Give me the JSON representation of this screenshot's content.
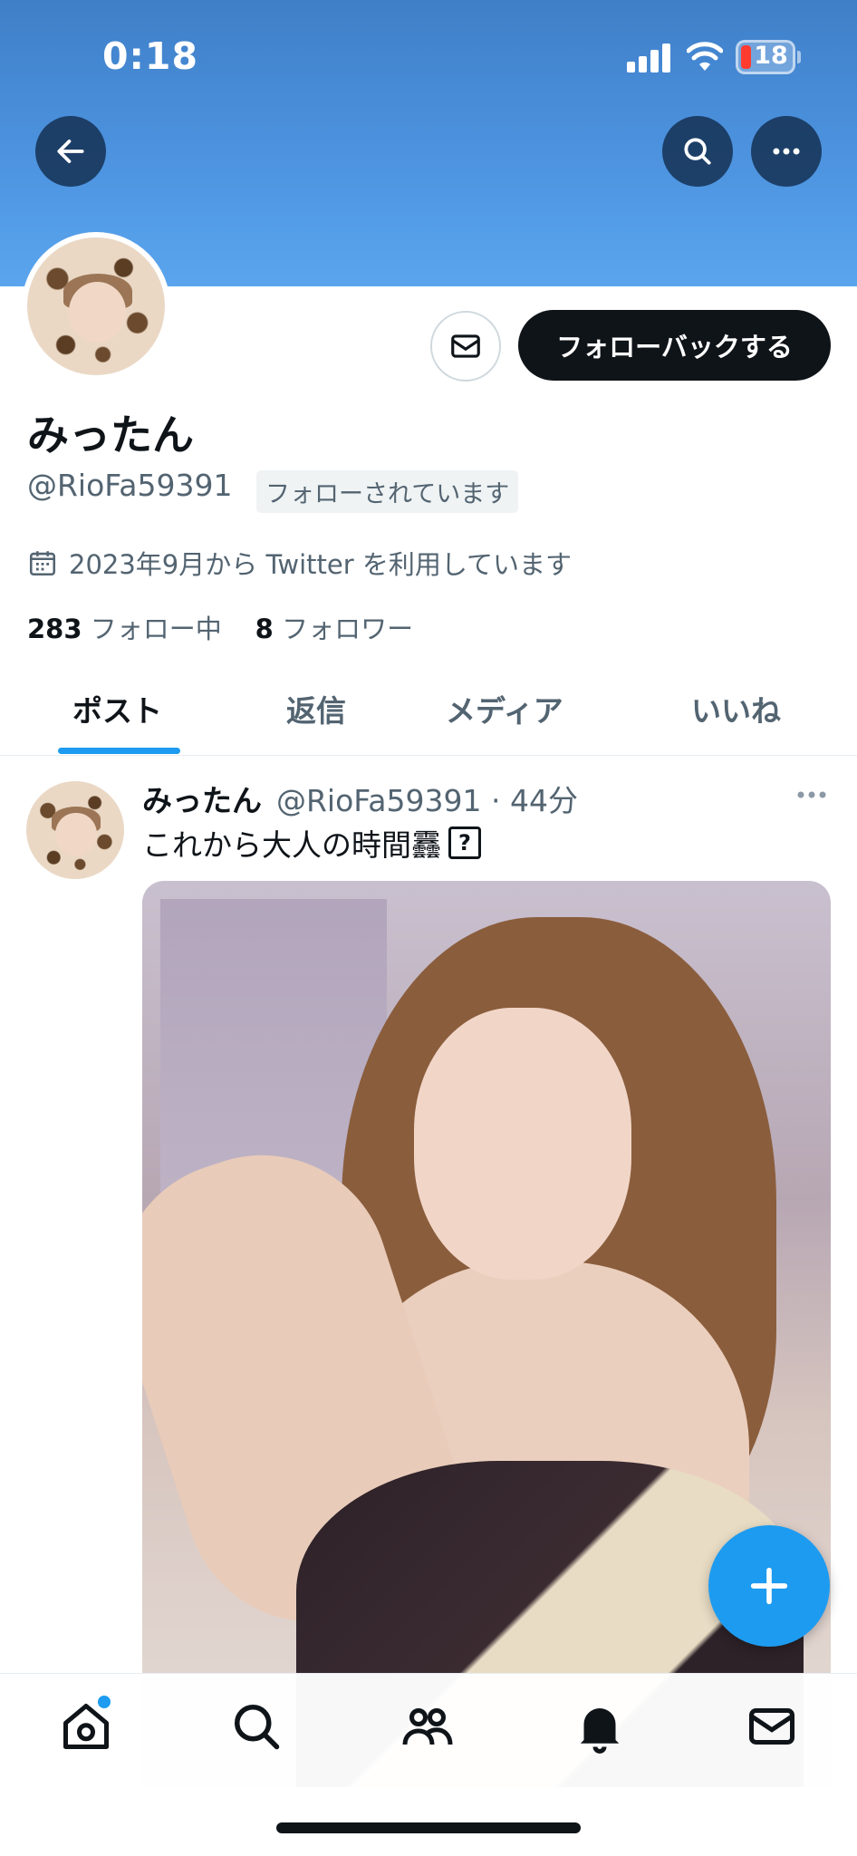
{
  "status_bar": {
    "time": "0:18",
    "battery": "18"
  },
  "profile": {
    "display_name": "みったん",
    "handle": "@RioFa59391",
    "follows_you": "フォローされています",
    "joined": "2023年9月から Twitter を利用しています",
    "following_count": "283",
    "following_label": "フォロー中",
    "followers_count": "8",
    "followers_label": "フォロワー",
    "follow_button": "フォローバックする"
  },
  "tabs": [
    {
      "label": "ポスト",
      "active": true
    },
    {
      "label": "返信",
      "active": false
    },
    {
      "label": "メディア",
      "active": false
    },
    {
      "label": "いいね",
      "active": false
    }
  ],
  "tweet": {
    "name": "みったん",
    "handle": "@RioFa59391",
    "separator": "·",
    "time": "44分",
    "text": "これから大人の時間䨺",
    "emoji_placeholder": "?"
  },
  "icons": {
    "back": "back-arrow-icon",
    "search": "search-icon",
    "more": "more-icon",
    "message": "mail-icon",
    "calendar": "calendar-icon",
    "compose": "plus-icon",
    "nav": [
      "home-icon",
      "search-icon",
      "communities-icon",
      "bell-icon",
      "mail-icon"
    ]
  },
  "colors": {
    "accent": "#1d9bf0",
    "banner": "#4d93df",
    "text": "#0f1419",
    "muted": "#536471"
  }
}
